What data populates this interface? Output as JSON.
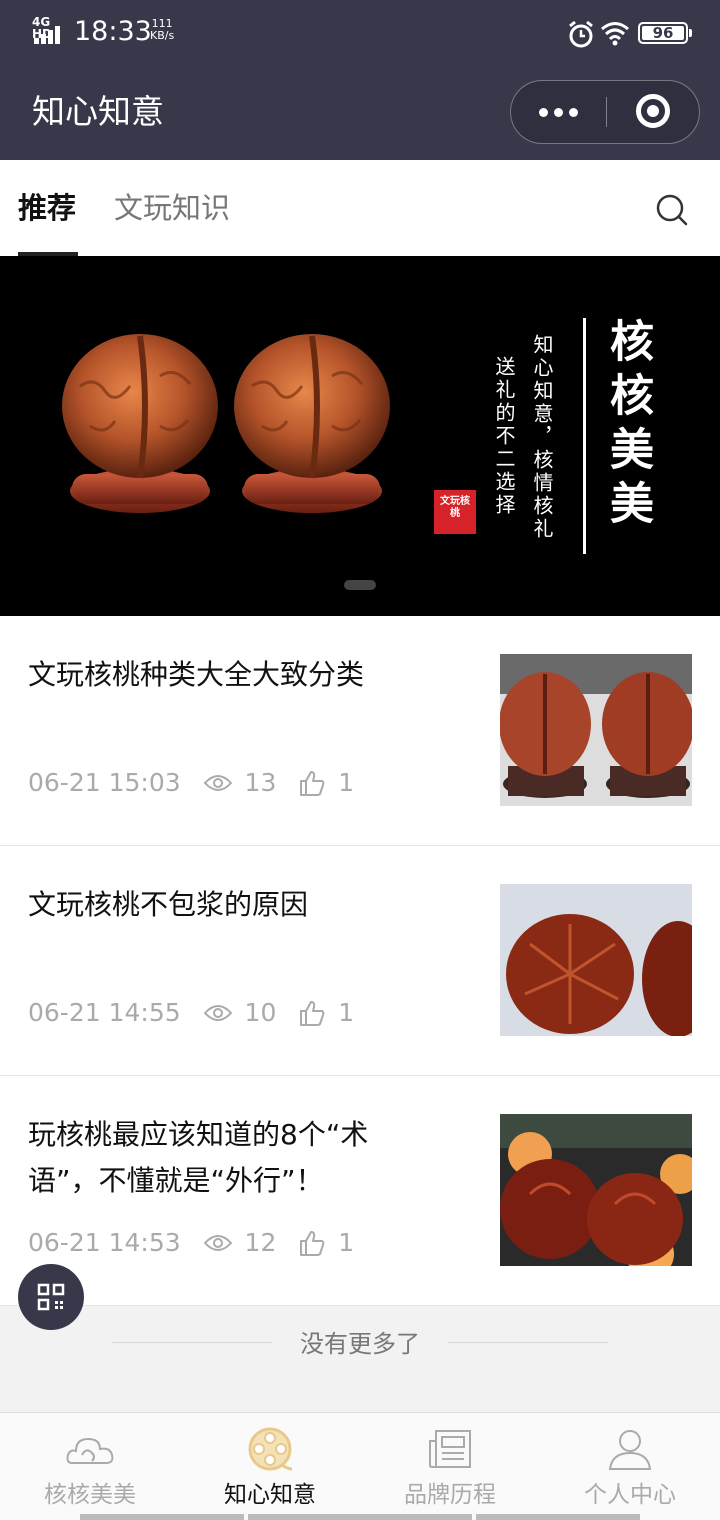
{
  "status_bar": {
    "network": "4G HD",
    "time": "18:33",
    "speed_value": "111",
    "speed_unit": "KB/s",
    "battery": "96"
  },
  "header": {
    "title": "知心知意"
  },
  "tabs": [
    {
      "label": "推荐",
      "active": true
    },
    {
      "label": "文玩知识",
      "active": false
    }
  ],
  "banner": {
    "big_text": "核核美美",
    "line1": "知心知意，核情核礼",
    "line2": "送礼的不二选择",
    "seal_text": "文玩核桃",
    "active_dot": 1
  },
  "articles": [
    {
      "title": "文玩核桃种类大全大致分类",
      "date": "06-21 15:03",
      "views": "13",
      "likes": "1"
    },
    {
      "title": "文玩核桃不包浆的原因",
      "date": "06-21 14:55",
      "views": "10",
      "likes": "1"
    },
    {
      "title": "玩核桃最应该知道的8个“术语”，不懂就是“外行”！",
      "date": "06-21 14:53",
      "views": "12",
      "likes": "1"
    }
  ],
  "footer": {
    "no_more": "没有更多了"
  },
  "bottom_nav": [
    {
      "label": "核核美美",
      "icon": "cloud-icon",
      "active": false
    },
    {
      "label": "知心知意",
      "icon": "film-reel-icon",
      "active": true
    },
    {
      "label": "品牌历程",
      "icon": "newspaper-icon",
      "active": false
    },
    {
      "label": "个人中心",
      "icon": "person-icon",
      "active": false
    }
  ],
  "colors": {
    "header_bg": "#37394a",
    "active_nav_icon": "#e8c98a",
    "seal_red": "#d6232a"
  }
}
